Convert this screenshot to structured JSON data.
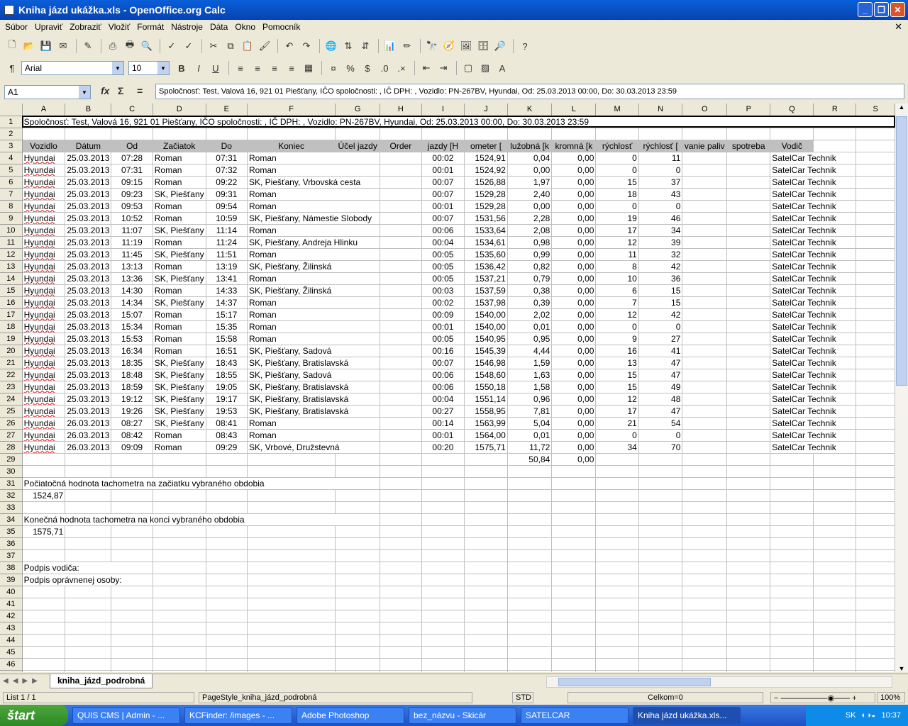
{
  "window": {
    "title": "Kniha jázd ukážka.xls - OpenOffice.org Calc",
    "controls": [
      "_",
      "❐",
      "✕"
    ]
  },
  "menu": [
    "Súbor",
    "Upraviť",
    "Zobraziť",
    "Vložiť",
    "Formát",
    "Nástroje",
    "Dáta",
    "Okno",
    "Pomocník"
  ],
  "formatting": {
    "font": "Arial",
    "size": "10",
    "bold": "B",
    "italic": "I",
    "underline": "U"
  },
  "formula": {
    "cell": "A1",
    "fx": "fx",
    "sum": "Σ",
    "eq": "=",
    "content": "Spoločnosť: Test, Valová 16, 921 01 Piešťany, IČO spoločnosti: , IČ DPH: , Vozidlo: PN-267BV, Hyundai, Od: 25.03.2013 00:00, Do: 30.03.2013 23:59"
  },
  "columns": [
    "A",
    "B",
    "C",
    "D",
    "E",
    "F",
    "G",
    "H",
    "I",
    "J",
    "K",
    "L",
    "M",
    "N",
    "O",
    "P",
    "Q",
    "R",
    "S"
  ],
  "row1": "Spoločnosť: Test, Valová 16, 921 01 Piešťany, IČO spoločnosti: , IČ DPH: , Vozidlo: PN-267BV, Hyundai, Od: 25.03.2013 00:00, Do: 30.03.2013 23:59",
  "headers": [
    "Vozidlo",
    "Dátum",
    "Od",
    "Začiatok",
    "Do",
    "Koniec",
    "Účel jazdy",
    "Order",
    "jazdy [H",
    "ometer [",
    "lužobná [k",
    "kromná [k",
    "rýchlosť",
    "rýchlosť [",
    "vanie paliv",
    "spotreba",
    "Vodič"
  ],
  "rows": [
    [
      "Hyundai",
      "25.03.2013",
      "07:28",
      "Roman",
      "07:31",
      "Roman",
      "00:02",
      "1524,91",
      "0,04",
      "0,00",
      "0",
      "11",
      "SatelCar Technik"
    ],
    [
      "Hyundai",
      "25.03.2013",
      "07:31",
      "Roman",
      "07:32",
      "Roman",
      "00:01",
      "1524,92",
      "0,00",
      "0,00",
      "0",
      "0",
      "SatelCar Technik"
    ],
    [
      "Hyundai",
      "25.03.2013",
      "09:15",
      "Roman",
      "09:22",
      "SK, Piešťany, Vrbovská cesta",
      "00:07",
      "1526,88",
      "1,97",
      "0,00",
      "15",
      "37",
      "SatelCar Technik"
    ],
    [
      "Hyundai",
      "25.03.2013",
      "09:23",
      "SK, Piešťany",
      "09:31",
      "Roman",
      "00:07",
      "1529,28",
      "2,40",
      "0,00",
      "18",
      "43",
      "SatelCar Technik"
    ],
    [
      "Hyundai",
      "25.03.2013",
      "09:53",
      "Roman",
      "09:54",
      "Roman",
      "00:01",
      "1529,28",
      "0,00",
      "0,00",
      "0",
      "0",
      "SatelCar Technik"
    ],
    [
      "Hyundai",
      "25.03.2013",
      "10:52",
      "Roman",
      "10:59",
      "SK, Piešťany, Námestie Slobody",
      "00:07",
      "1531,56",
      "2,28",
      "0,00",
      "19",
      "46",
      "SatelCar Technik"
    ],
    [
      "Hyundai",
      "25.03.2013",
      "11:07",
      "SK, Piešťany",
      "11:14",
      "Roman",
      "00:06",
      "1533,64",
      "2,08",
      "0,00",
      "17",
      "34",
      "SatelCar Technik"
    ],
    [
      "Hyundai",
      "25.03.2013",
      "11:19",
      "Roman",
      "11:24",
      "SK, Piešťany, Andreja Hlinku",
      "00:04",
      "1534,61",
      "0,98",
      "0,00",
      "12",
      "39",
      "SatelCar Technik"
    ],
    [
      "Hyundai",
      "25.03.2013",
      "11:45",
      "SK, Piešťany",
      "11:51",
      "Roman",
      "00:05",
      "1535,60",
      "0,99",
      "0,00",
      "11",
      "32",
      "SatelCar Technik"
    ],
    [
      "Hyundai",
      "25.03.2013",
      "13:13",
      "Roman",
      "13:19",
      "SK, Piešťany, Žilinská",
      "00:05",
      "1536,42",
      "0,82",
      "0,00",
      "8",
      "42",
      "SatelCar Technik"
    ],
    [
      "Hyundai",
      "25.03.2013",
      "13:36",
      "SK, Piešťany",
      "13:41",
      "Roman",
      "00:05",
      "1537,21",
      "0,79",
      "0,00",
      "10",
      "36",
      "SatelCar Technik"
    ],
    [
      "Hyundai",
      "25.03.2013",
      "14:30",
      "Roman",
      "14:33",
      "SK, Piešťany, Žilinská",
      "00:03",
      "1537,59",
      "0,38",
      "0,00",
      "6",
      "15",
      "SatelCar Technik"
    ],
    [
      "Hyundai",
      "25.03.2013",
      "14:34",
      "SK, Piešťany",
      "14:37",
      "Roman",
      "00:02",
      "1537,98",
      "0,39",
      "0,00",
      "7",
      "15",
      "SatelCar Technik"
    ],
    [
      "Hyundai",
      "25.03.2013",
      "15:07",
      "Roman",
      "15:17",
      "Roman",
      "00:09",
      "1540,00",
      "2,02",
      "0,00",
      "12",
      "42",
      "SatelCar Technik"
    ],
    [
      "Hyundai",
      "25.03.2013",
      "15:34",
      "Roman",
      "15:35",
      "Roman",
      "00:01",
      "1540,00",
      "0,01",
      "0,00",
      "0",
      "0",
      "SatelCar Technik"
    ],
    [
      "Hyundai",
      "25.03.2013",
      "15:53",
      "Roman",
      "15:58",
      "Roman",
      "00:05",
      "1540,95",
      "0,95",
      "0,00",
      "9",
      "27",
      "SatelCar Technik"
    ],
    [
      "Hyundai",
      "25.03.2013",
      "16:34",
      "Roman",
      "16:51",
      "SK, Piešťany, Sadová",
      "00:16",
      "1545,39",
      "4,44",
      "0,00",
      "16",
      "41",
      "SatelCar Technik"
    ],
    [
      "Hyundai",
      "25.03.2013",
      "18:35",
      "SK, Piešťany",
      "18:43",
      "SK, Piešťany, Bratislavská",
      "00:07",
      "1546,98",
      "1,59",
      "0,00",
      "13",
      "47",
      "SatelCar Technik"
    ],
    [
      "Hyundai",
      "25.03.2013",
      "18:48",
      "SK, Piešťany",
      "18:55",
      "SK, Piešťany, Sadová",
      "00:06",
      "1548,60",
      "1,63",
      "0,00",
      "15",
      "47",
      "SatelCar Technik"
    ],
    [
      "Hyundai",
      "25.03.2013",
      "18:59",
      "SK, Piešťany",
      "19:05",
      "SK, Piešťany, Bratislavská",
      "00:06",
      "1550,18",
      "1,58",
      "0,00",
      "15",
      "49",
      "SatelCar Technik"
    ],
    [
      "Hyundai",
      "25.03.2013",
      "19:12",
      "SK, Piešťany",
      "19:17",
      "SK, Piešťany, Bratislavská",
      "00:04",
      "1551,14",
      "0,96",
      "0,00",
      "12",
      "48",
      "SatelCar Technik"
    ],
    [
      "Hyundai",
      "25.03.2013",
      "19:26",
      "SK, Piešťany",
      "19:53",
      "SK, Piešťany, Bratislavská",
      "00:27",
      "1558,95",
      "7,81",
      "0,00",
      "17",
      "47",
      "SatelCar Technik"
    ],
    [
      "Hyundai",
      "26.03.2013",
      "08:27",
      "SK, Piešťany",
      "08:41",
      "Roman",
      "00:14",
      "1563,99",
      "5,04",
      "0,00",
      "21",
      "54",
      "SatelCar Technik"
    ],
    [
      "Hyundai",
      "26.03.2013",
      "08:42",
      "Roman",
      "08:43",
      "Roman",
      "00:01",
      "1564,00",
      "0,01",
      "0,00",
      "0",
      "0",
      "SatelCar Technik"
    ],
    [
      "Hyundai",
      "26.03.2013",
      "09:09",
      "Roman",
      "09:29",
      "SK, Vrbové, Družstevná",
      "00:20",
      "1575,71",
      "11,72",
      "0,00",
      "34",
      "70",
      "SatelCar Technik"
    ]
  ],
  "totals": {
    "k": "50,84",
    "l": "0,00"
  },
  "notes": {
    "r31": "Počiatočná hodnota tachometra na začiatku vybraného obdobia",
    "r32": "1524,87",
    "r34": "Konečná hodnota tachometra na konci vybraného obdobia",
    "r35": "1575,71",
    "r38": "Podpis vodiča:",
    "r39": "Podpis oprávnenej osoby:"
  },
  "sheet_tab": "kniha_jázd_podrobná",
  "status": {
    "sheet": "List 1 / 1",
    "style": "PageStyle_kniha_jázd_podrobná",
    "mode": "STD",
    "sum": "Celkom=0",
    "zoom": "100%"
  },
  "taskbar": {
    "start": "štart",
    "tasks": [
      "QUIS CMS | Admin - ...",
      "KCFinder: /images - ...",
      "Adobe Photoshop",
      "bez_názvu - Skicár",
      "SATELCAR",
      "Kniha jázd ukážka.xls..."
    ],
    "lang": "SK",
    "time": "10:37"
  }
}
